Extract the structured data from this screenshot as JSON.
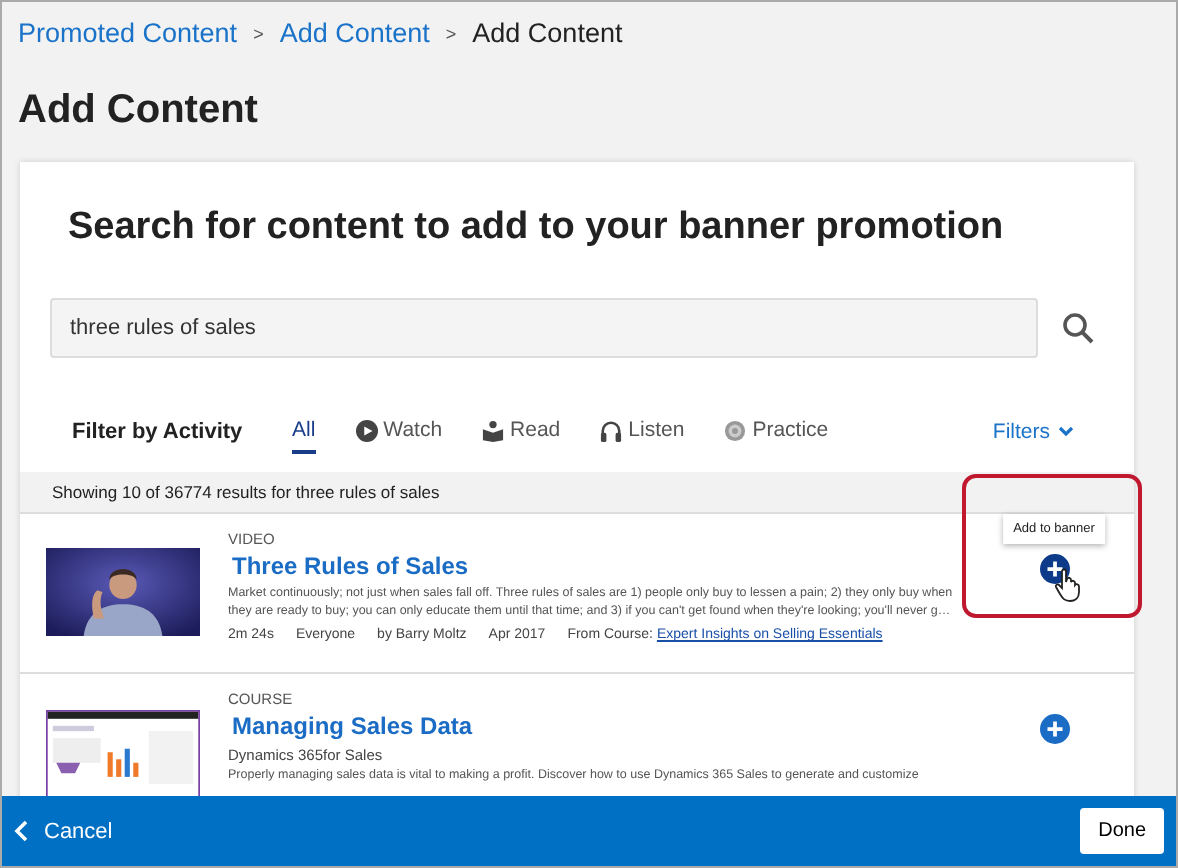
{
  "breadcrumb": [
    {
      "label": "Promoted Content",
      "link": true
    },
    {
      "label": "Add Content",
      "link": true
    },
    {
      "label": "Add Content",
      "link": false
    }
  ],
  "breadcrumb_separator": ">",
  "page_title": "Add Content",
  "card_title": "Search for content to add to your banner promotion",
  "search": {
    "value": "three rules of sales"
  },
  "filter_label": "Filter by Activity",
  "tabs": [
    {
      "label": "All",
      "selected": true
    },
    {
      "label": "Watch",
      "selected": false
    },
    {
      "label": "Read",
      "selected": false
    },
    {
      "label": "Listen",
      "selected": false
    },
    {
      "label": "Practice",
      "selected": false
    }
  ],
  "filters_button": "Filters",
  "results_summary": "Showing 10 of 36774 results for three rules of sales",
  "results": [
    {
      "kind": "video",
      "type_label": "VIDEO",
      "title": "Three Rules of Sales",
      "description_lines": [
        "Market continuously; not just when sales fall off. Three rules of sales are 1) people only buy to lessen a pain; 2) they only buy when",
        "they are ready to buy; you can only educate them until that time; and 3) if you can't get found when they're looking; you'll never g…"
      ],
      "meta": [
        "2m 24s",
        "Everyone",
        "by Barry Moltz",
        "Apr 2017"
      ],
      "course_label": "From Course:",
      "course_link": "Expert Insights on Selling Essentials",
      "hovered": true,
      "tooltip": "Add to banner"
    },
    {
      "kind": "course",
      "type_label": "COURSE",
      "title": "Managing Sales Data",
      "subtitle": "Dynamics 365for Sales",
      "description_lines": [
        "Properly managing sales data is vital to making a profit. Discover how to use Dynamics 365 Sales to generate and customize"
      ],
      "hovered": false
    }
  ],
  "footer": {
    "cancel": "Cancel",
    "done": "Done"
  }
}
